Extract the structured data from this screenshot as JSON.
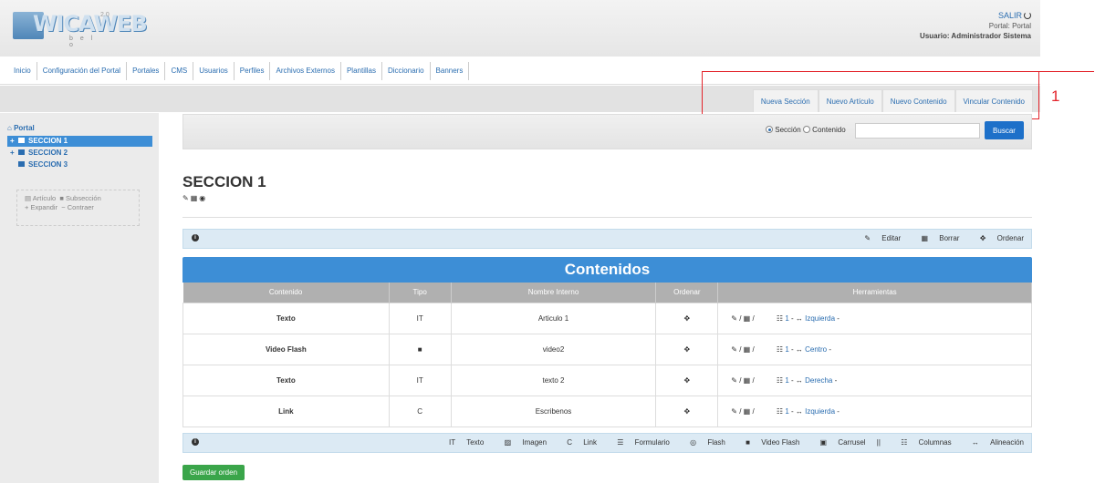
{
  "header": {
    "logo_text": "WICAWEB",
    "logo_version": "2.0",
    "logo_sub": "b e l o",
    "logout_label": "SALIR",
    "portal_label": "Portal: Portal",
    "user_label": "Usuario: Administrador Sistema"
  },
  "main_nav": [
    "Inicio",
    "Configuración del Portal",
    "Portales",
    "CMS",
    "Usuarios",
    "Perfiles",
    "Archivos Externos",
    "Plantillas",
    "Diccionario",
    "Banners"
  ],
  "sub_nav": [
    "Nueva Sección",
    "Nuevo Artículo",
    "Nuevo Contenido",
    "Vincular Contenido"
  ],
  "annotation": {
    "number": "1",
    "color": "#e3242b"
  },
  "sidebar": {
    "root": "Portal",
    "items": [
      {
        "label": "SECCION 1",
        "active": true,
        "toggle": "+"
      },
      {
        "label": "SECCION 2",
        "active": false,
        "toggle": "+"
      },
      {
        "label": "SECCION 3",
        "active": false,
        "toggle": ""
      }
    ],
    "legend": {
      "articulo": "Artículo",
      "subseccion": "Subsección",
      "expandir": "Expandir",
      "contraer": "Contraer"
    }
  },
  "search": {
    "option_section": "Sección",
    "option_content": "Contenido",
    "selected": "Sección",
    "value": "",
    "button": "Buscar"
  },
  "section": {
    "title": "SECCION 1",
    "edit_actions": {
      "editar": "Editar",
      "borrar": "Borrar",
      "ordenar": "Ordenar"
    }
  },
  "contents": {
    "title": "Contenidos",
    "columns": [
      "Contenido",
      "Tipo",
      "Nombre Interno",
      "Ordenar",
      "Herramientas"
    ],
    "rows": [
      {
        "contenido": "Texto",
        "tipo_icon": "IT",
        "nombre": "Articulo 1",
        "cols": "1",
        "align": "Izquierda"
      },
      {
        "contenido": "Video Flash",
        "tipo_icon": "■",
        "nombre": "video2",
        "cols": "1",
        "align": "Centro"
      },
      {
        "contenido": "Texto",
        "tipo_icon": "IT",
        "nombre": "texto 2",
        "cols": "1",
        "align": "Derecha"
      },
      {
        "contenido": "Link",
        "tipo_icon": "C",
        "nombre": "Escribenos",
        "cols": "1",
        "align": "Izquierda"
      }
    ]
  },
  "add_toolbar": [
    "Texto",
    "Imagen",
    "Link",
    "Formulario",
    "Flash",
    "Video Flash",
    "Carrusel",
    "Columnas",
    "Alineación"
  ],
  "save_order_label": "Guardar orden",
  "colors": {
    "accent": "#3d8ed6",
    "save_button": "#3aa54a",
    "link": "#2a6db0"
  }
}
